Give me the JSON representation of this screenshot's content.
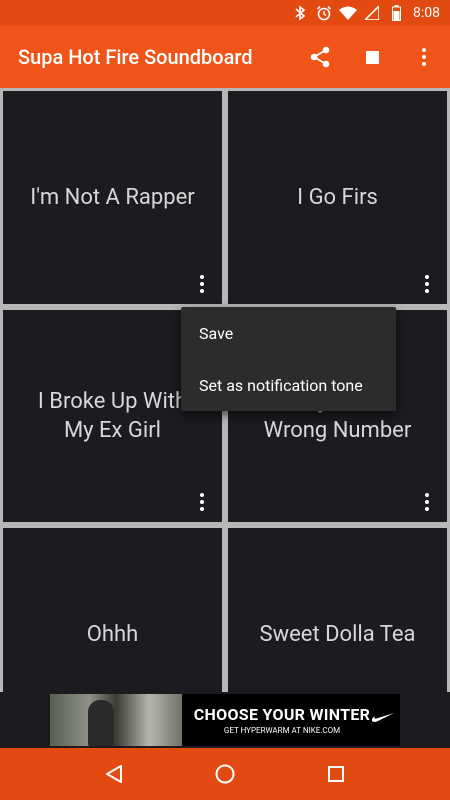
{
  "status_bar": {
    "time": "8:08",
    "icons": [
      "bluetooth-icon",
      "alarm-icon",
      "wifi-icon",
      "signal-icon",
      "battery-icon"
    ]
  },
  "app_bar": {
    "title": "Supa Hot Fire Soundboard",
    "actions": [
      "share-icon",
      "stop-icon",
      "overflow-menu-icon"
    ]
  },
  "tiles": [
    {
      "label": "I'm Not A Rapper"
    },
    {
      "label": "I Go Firs"
    },
    {
      "label": "I Broke Up With\nMy Ex Girl"
    },
    {
      "label": "...y ...ne\nWrong Number"
    },
    {
      "label": "Ohhh"
    },
    {
      "label": "Sweet Dolla Tea"
    }
  ],
  "popup_menu": {
    "items": [
      {
        "label": "Save"
      },
      {
        "label": "Set as notification tone"
      }
    ]
  },
  "ad": {
    "headline": "CHOOSE YOUR WINTER",
    "subline": "GET HYPERWARM AT NIKE.COM"
  },
  "nav_bar": {
    "buttons": [
      "back-icon",
      "home-icon",
      "recents-icon"
    ]
  },
  "colors": {
    "status_bar": "#e24a12",
    "app_bar": "#f05418",
    "tile": "#1c1b20",
    "grid_gap": "#b7b7b7",
    "menu": "#2c2c2c"
  }
}
